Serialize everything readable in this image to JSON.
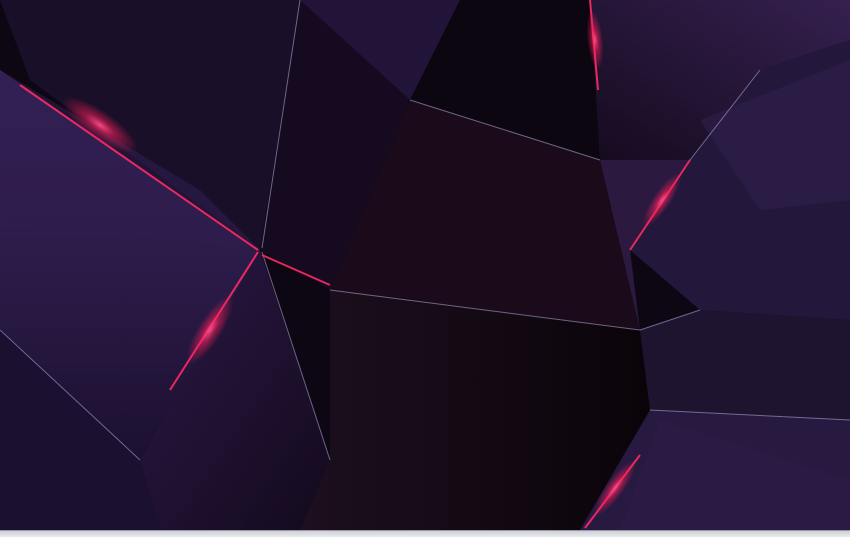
{
  "screen": {
    "description": "",
    "watermark": ""
  },
  "colors": {
    "background_dark": "#0b0611",
    "facet_purple": "#2a1843",
    "facet_deep": "#1a0d26",
    "glow_magenta": "#ff2a63",
    "edge_light": "#b9b2e0",
    "taskbar": "#e3e4e8"
  }
}
